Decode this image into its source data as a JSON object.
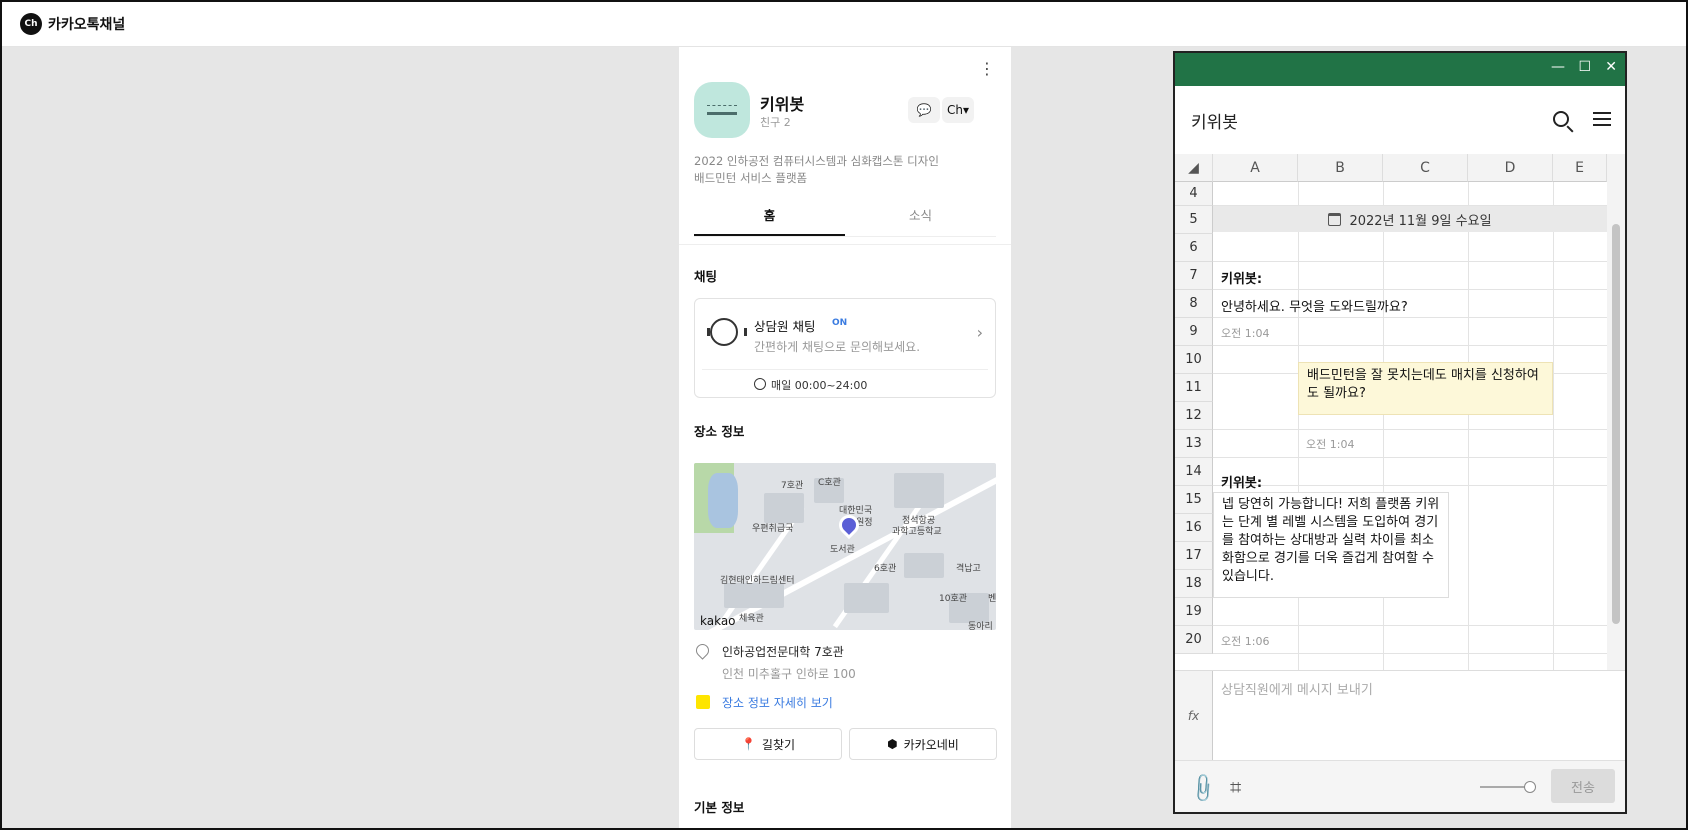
{
  "topbar": {
    "logo_text": "Ch",
    "brand": "카카오톡채널"
  },
  "profile": {
    "name": "키위봇",
    "friends": "친구 2",
    "description": "2022 인하공전 컴퓨터시스템과 심화캡스톤 디자인\n배드민턴 서비스 플랫폼",
    "tabs": [
      "홈",
      "소식"
    ],
    "chat_section": "채팅",
    "chat_title": "상담원 채팅",
    "chat_badge": "ON",
    "chat_sub": "간편하게 채팅으로 문의해보세요.",
    "chat_hours": "매일 00:00~24:00",
    "place_section": "장소 정보",
    "map_labels": [
      "7호관",
      "C호관",
      "대한민국",
      "원정",
      "우편취급국",
      "정석항공",
      "과학고등학교",
      "도서관",
      "6호관",
      "격납고",
      "김현태인하드림센터",
      "10호관",
      "체육관",
      "동아리",
      "벤"
    ],
    "map_brand": "kakao",
    "address1": "인하공업전문대학 7호관",
    "address2": "인천 미추홀구 인하로 100",
    "detail_link": "장소 정보 자세히 보기",
    "btn_route": "길찾기",
    "btn_navi": "카카오네비",
    "basic_section": "기본 정보"
  },
  "chat_window": {
    "controls": [
      "—",
      "☐",
      "✕"
    ],
    "title": "키위봇",
    "columns": [
      "A",
      "B",
      "C",
      "D",
      "E"
    ],
    "rows": [
      "4",
      "5",
      "6",
      "7",
      "8",
      "9",
      "10",
      "11",
      "12",
      "13",
      "14",
      "15",
      "16",
      "17",
      "18",
      "19",
      "20"
    ],
    "date": "2022년 11월 9일 수요일",
    "bot_label_1": "키위봇:",
    "bot_msg_1": "안녕하세요. 무엇을 도와드릴까요?",
    "time_1": "오전 1:04",
    "user_msg": "배드민턴을 잘 못치는데도 매치를 신청하여도 될까요?",
    "time_2": "오전 1:04",
    "bot_label_2": "키위봇:",
    "bot_msg_2": "넵 당연히 가능합니다! 저희 플랫폼 키위는 단계 별 레벨 시스템을 도입하여 경기를 참여하는 상대방과 실력 차이를 최소화함으로 경기를 더욱 즐겁게 참여할 수 있습니다.",
    "time_3": "오전 1:06",
    "fx_label": "fx",
    "input_placeholder": "상담직원에게 메시지 보내기",
    "send_label": "전송"
  }
}
